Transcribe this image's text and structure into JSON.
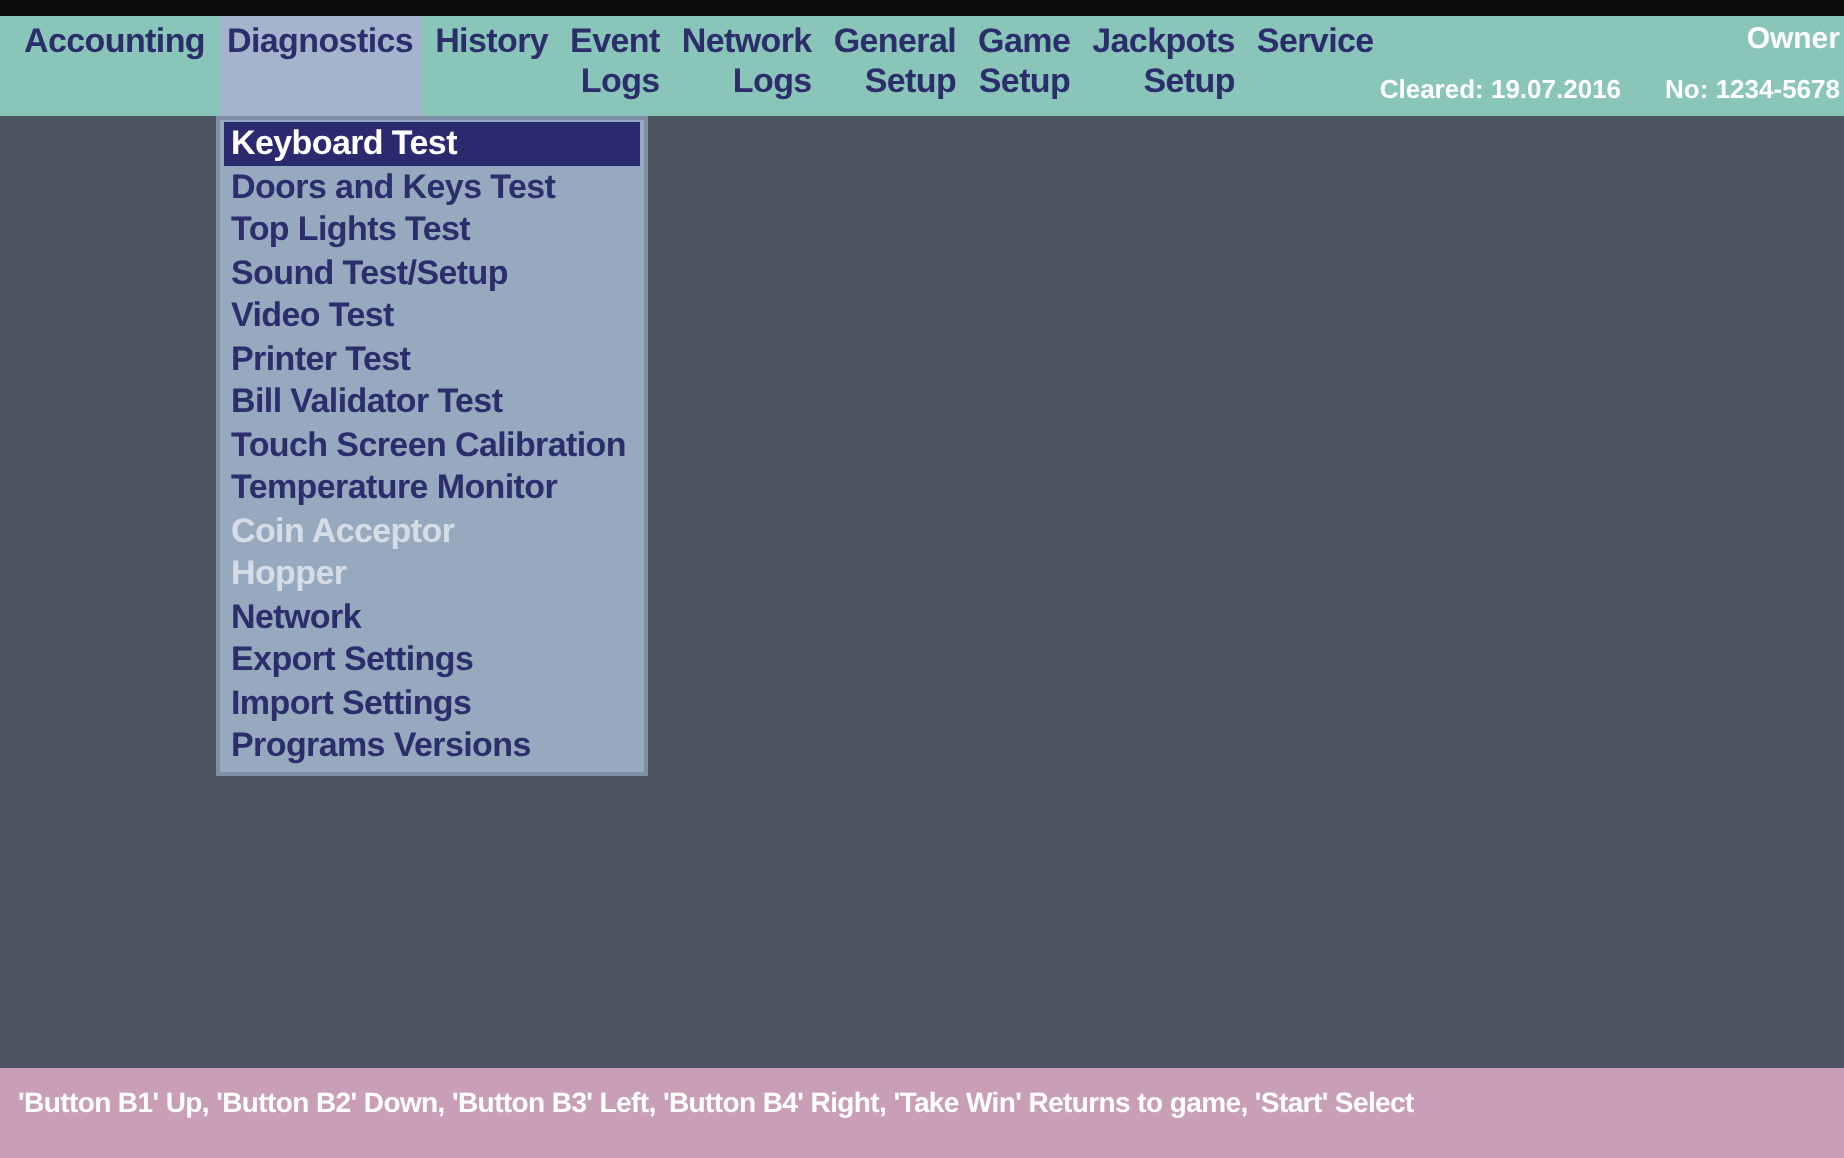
{
  "menu": [
    {
      "lines": [
        "Accounting"
      ],
      "selected": false
    },
    {
      "lines": [
        "Diagnostics"
      ],
      "selected": true
    },
    {
      "lines": [
        "History"
      ],
      "selected": false
    },
    {
      "lines": [
        "Event",
        "Logs"
      ],
      "selected": false
    },
    {
      "lines": [
        "Network",
        "Logs"
      ],
      "selected": false
    },
    {
      "lines": [
        "General",
        "Setup"
      ],
      "selected": false
    },
    {
      "lines": [
        "Game",
        "Setup"
      ],
      "selected": false
    },
    {
      "lines": [
        "Jackpots",
        "Setup"
      ],
      "selected": false
    },
    {
      "lines": [
        "Service"
      ],
      "selected": false
    }
  ],
  "info": {
    "owner": "Owner",
    "cleared": "Cleared: 19.07.2016",
    "number": "No: 1234-5678"
  },
  "dropdown": [
    {
      "label": "Keyboard Test",
      "selected": true,
      "disabled": false
    },
    {
      "label": "Doors and Keys Test",
      "selected": false,
      "disabled": false
    },
    {
      "label": "Top Lights Test",
      "selected": false,
      "disabled": false
    },
    {
      "label": "Sound Test/Setup",
      "selected": false,
      "disabled": false
    },
    {
      "label": "Video Test",
      "selected": false,
      "disabled": false
    },
    {
      "label": "Printer Test",
      "selected": false,
      "disabled": false
    },
    {
      "label": "Bill Validator Test",
      "selected": false,
      "disabled": false
    },
    {
      "label": "Touch Screen Calibration",
      "selected": false,
      "disabled": false
    },
    {
      "label": "Temperature Monitor",
      "selected": false,
      "disabled": false
    },
    {
      "label": "Coin Acceptor",
      "selected": false,
      "disabled": true
    },
    {
      "label": "Hopper",
      "selected": false,
      "disabled": true
    },
    {
      "label": "Network",
      "selected": false,
      "disabled": false
    },
    {
      "label": "Export Settings",
      "selected": false,
      "disabled": false
    },
    {
      "label": "Import Settings",
      "selected": false,
      "disabled": false
    },
    {
      "label": "Programs Versions",
      "selected": false,
      "disabled": false
    }
  ],
  "status_bar": "'Button B1' Up, 'Button B2' Down, 'Button B3' Left, 'Button B4' Right, 'Take Win' Returns to game, 'Start' Select"
}
